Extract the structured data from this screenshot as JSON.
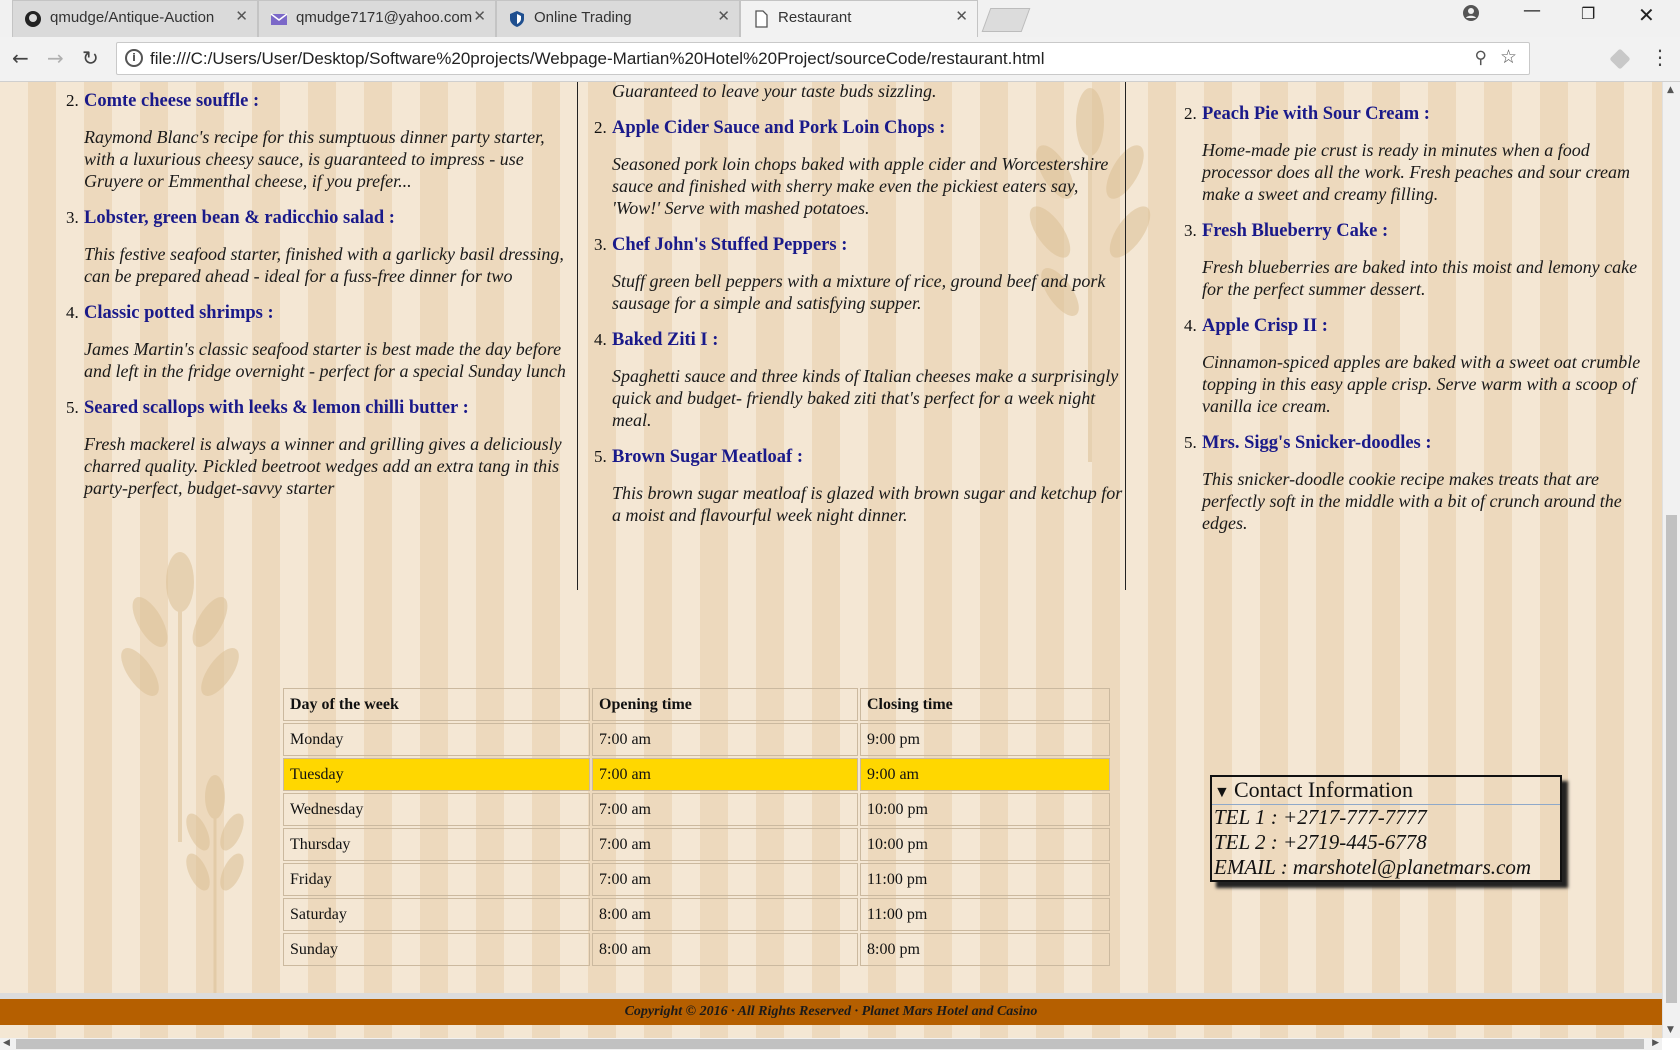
{
  "browser": {
    "tabs": [
      {
        "title": "qmudge/Antique-Auction",
        "icon": "github-icon",
        "active": false
      },
      {
        "title": "qmudge7171@yahoo.com",
        "icon": "mail-icon",
        "active": false
      },
      {
        "title": "Online Trading",
        "icon": "shield-icon",
        "active": false
      },
      {
        "title": "Restaurant",
        "icon": "page-icon",
        "active": true
      }
    ],
    "close_glyph": "✕",
    "url": "file:///C:/Users/User/Desktop/Software%20projects/Webpage-Martian%20Hotel%20Project/sourceCode/restaurant.html",
    "colors": {
      "highlight": "#ffd700",
      "footer": "#b55f00",
      "dish_title": "#1a1a8a"
    }
  },
  "menu": {
    "col1": [
      {
        "num": "2.",
        "title": "Comte cheese souffle :",
        "desc": "Raymond Blanc's recipe for this sumptuous dinner party starter, with a luxurious cheesy sauce, is guaranteed to impress - use Gruyere or Emmenthal cheese, if you prefer..."
      },
      {
        "num": "3.",
        "title": "Lobster, green bean & radicchio salad :",
        "desc": "This festive seafood starter, finished with a garlicky basil dressing, can be prepared ahead - ideal for a fuss-free dinner for two"
      },
      {
        "num": "4.",
        "title": "Classic potted shrimps :",
        "desc": "James Martin's classic seafood starter is best made the day before and left in the fridge overnight - perfect for a special Sunday lunch"
      },
      {
        "num": "5.",
        "title": "Seared scallops with leeks & lemon chilli butter :",
        "desc": "Fresh mackerel is always a winner and grilling gives a deliciously charred quality. Pickled beetroot wedges add an extra tang in this party-perfect, budget-savvy starter"
      }
    ],
    "col2_intro": "Guaranteed to leave your taste buds sizzling.",
    "col2": [
      {
        "num": "2.",
        "title": "Apple Cider Sauce and Pork Loin Chops :",
        "desc": "Seasoned pork loin chops baked with apple cider and Worcestershire sauce and finished with sherry make even the pickiest eaters say, 'Wow!' Serve with mashed potatoes."
      },
      {
        "num": "3.",
        "title": "Chef John's Stuffed Peppers :",
        "desc": "Stuff green bell peppers with a mixture of rice, ground beef and pork sausage for a simple and satisfying supper."
      },
      {
        "num": "4.",
        "title": "Baked Ziti I :",
        "desc": "Spaghetti sauce and three kinds of Italian cheeses make a surprisingly quick and budget- friendly baked ziti that's perfect for a week night meal."
      },
      {
        "num": "5.",
        "title": "Brown Sugar Meatloaf :",
        "desc": "This brown sugar meatloaf is glazed with brown sugar and ketchup for a moist and flavourful week night dinner."
      }
    ],
    "col3": [
      {
        "num": "2.",
        "title": "Peach Pie with Sour Cream :",
        "desc": "Home-made pie crust is ready in minutes when a food processor does all the work. Fresh peaches and sour cream make a sweet and creamy filling."
      },
      {
        "num": "3.",
        "title": "Fresh Blueberry Cake :",
        "desc": "Fresh blueberries are baked into this moist and lemony cake for the perfect summer dessert."
      },
      {
        "num": "4.",
        "title": "Apple Crisp II :",
        "desc": "Cinnamon-spiced apples are baked with a sweet oat crumble topping in this easy apple crisp. Serve warm with a scoop of vanilla ice cream."
      },
      {
        "num": "5.",
        "title": "Mrs. Sigg's Snicker-doodles :",
        "desc": "This snicker-doodle cookie recipe makes treats that are perfectly soft in the middle with a bit of crunch around the edges."
      }
    ]
  },
  "hours": {
    "headers": [
      "Day of the week",
      "Opening time",
      "Closing time"
    ],
    "rows": [
      {
        "day": "Monday",
        "open": "7:00 am",
        "close": "9:00 pm",
        "highlight": false
      },
      {
        "day": "Tuesday",
        "open": "7:00 am",
        "close": "9:00 am",
        "highlight": true
      },
      {
        "day": "Wednesday",
        "open": "7:00 am",
        "close": "10:00 pm",
        "highlight": false
      },
      {
        "day": "Thursday",
        "open": "7:00 am",
        "close": "10:00 pm",
        "highlight": false
      },
      {
        "day": "Friday",
        "open": "7:00 am",
        "close": "11:00 pm",
        "highlight": false
      },
      {
        "day": "Saturday",
        "open": "8:00 am",
        "close": "11:00 pm",
        "highlight": false
      },
      {
        "day": "Sunday",
        "open": "8:00 am",
        "close": "8:00 pm",
        "highlight": false
      }
    ]
  },
  "contact": {
    "summary": "Contact Information",
    "tel1": "TEL 1 : +2717-777-7777",
    "tel2": "TEL 2 : +2719-445-6778",
    "email": "EMAIL : marshotel@planetmars.com"
  },
  "footer": {
    "text": "Copyright © 2016 · All Rights Reserved · Planet Mars Hotel and Casino"
  }
}
